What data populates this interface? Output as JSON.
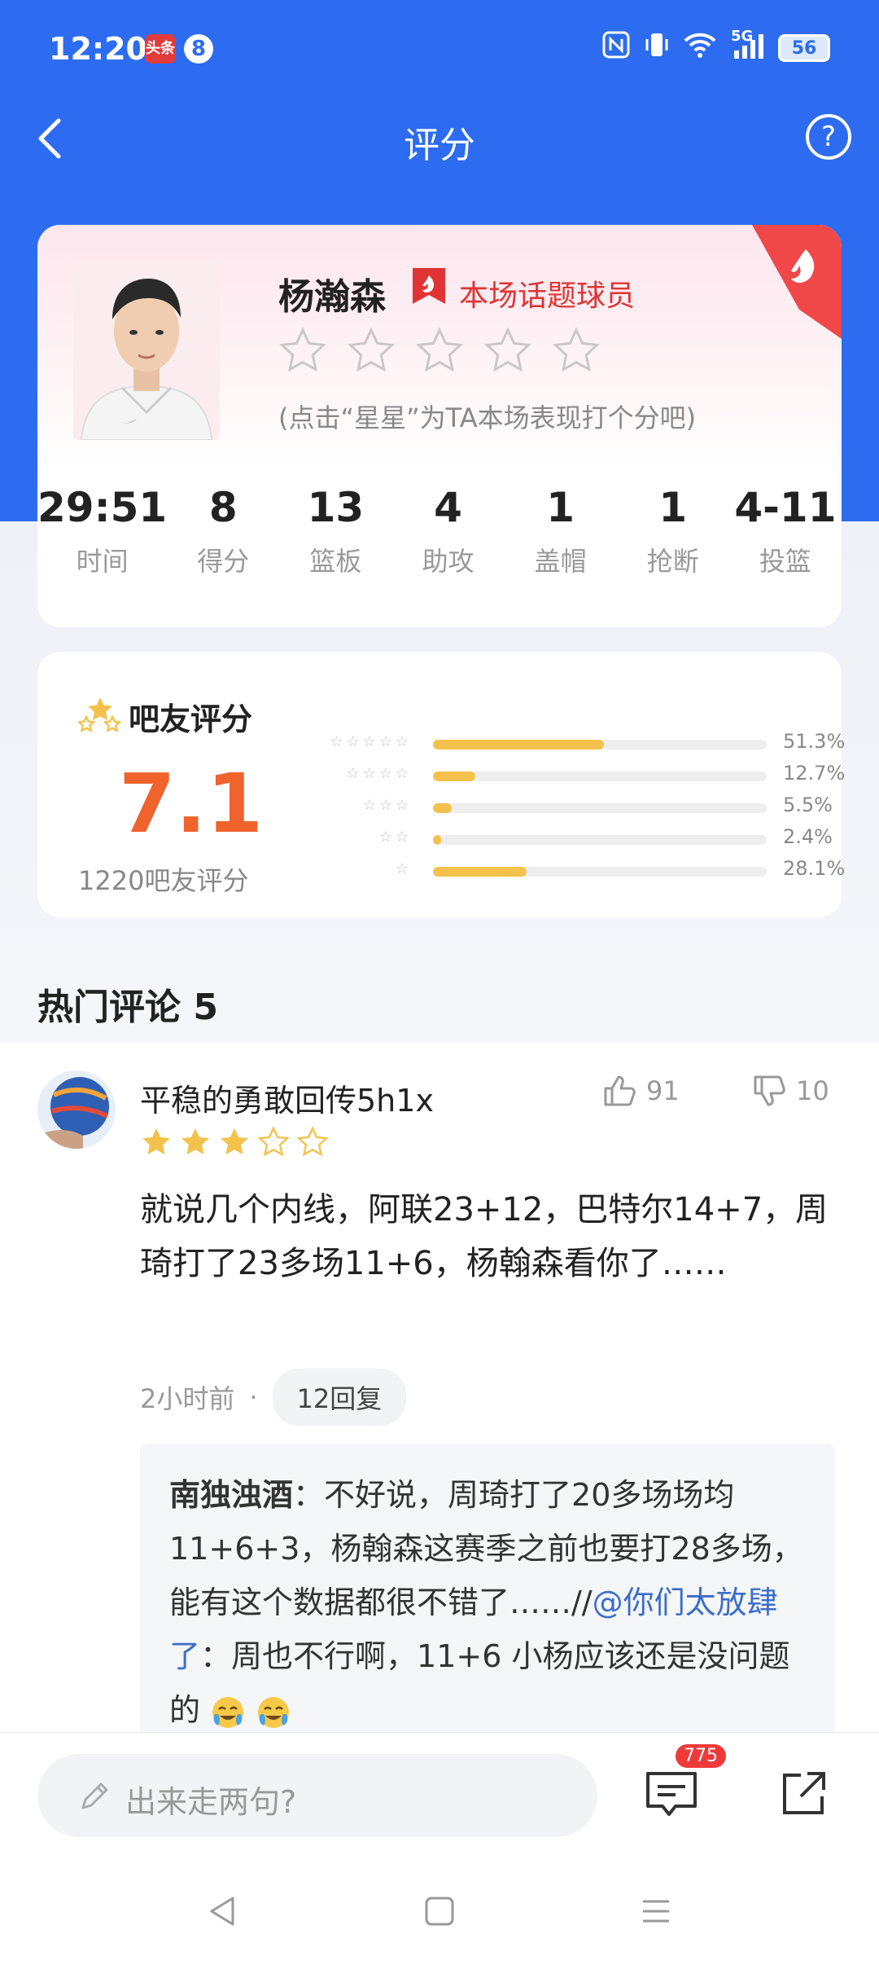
{
  "status_bar": {
    "time": "12:20",
    "app_badge_1": "头条",
    "app_badge_2": "8",
    "network": "5G",
    "battery": "56"
  },
  "header": {
    "title": "评分",
    "help": "?"
  },
  "player": {
    "name": "杨瀚森",
    "tag": "本场话题球员",
    "rating_hint": "(点击“星星”为TA本场表现打个分吧)",
    "stats": [
      {
        "value": "29:51",
        "label": "时间"
      },
      {
        "value": "8",
        "label": "得分"
      },
      {
        "value": "13",
        "label": "篮板"
      },
      {
        "value": "4",
        "label": "助攻"
      },
      {
        "value": "1",
        "label": "盖帽"
      },
      {
        "value": "1",
        "label": "抢断"
      },
      {
        "value": "4-11",
        "label": "投篮"
      }
    ]
  },
  "fan_rating": {
    "title": "吧友评分",
    "score": "7.1",
    "count_text": "1220吧友评分",
    "distribution": [
      {
        "stars": 5,
        "percent": "51.3%",
        "fraction": 0.513
      },
      {
        "stars": 4,
        "percent": "12.7%",
        "fraction": 0.127
      },
      {
        "stars": 3,
        "percent": "5.5%",
        "fraction": 0.055
      },
      {
        "stars": 2,
        "percent": "2.4%",
        "fraction": 0.024
      },
      {
        "stars": 1,
        "percent": "28.1%",
        "fraction": 0.281
      }
    ]
  },
  "comments": {
    "title": "热门评论 5",
    "items": [
      {
        "user": "平稳的勇敢回传5h1x",
        "rating": 3,
        "likes": "91",
        "dislikes": "10",
        "text": "就说几个内线，阿联23+12，巴特尔14+7，周琦打了23多场11+6，杨翰森看你了……",
        "time": "2小时前",
        "reply_count": "12回复",
        "reply": {
          "user": "南独浊酒",
          "text": "：不好说，周琦打了20多场场均11+6+3，杨翰森这赛季之前也要打28多场，能有这个数据都很不错了……//",
          "at_user": "@你们太放肆了",
          "at_text": "：周也不行啊，11+6 小杨应该还是没问题的"
        }
      }
    ]
  },
  "bottom": {
    "input_placeholder": "出来走两句?",
    "comment_count": "775"
  },
  "colors": {
    "primary": "#2d6cf0",
    "score": "#f0632c",
    "star": "#f4c24c",
    "hot": "#e03434"
  }
}
